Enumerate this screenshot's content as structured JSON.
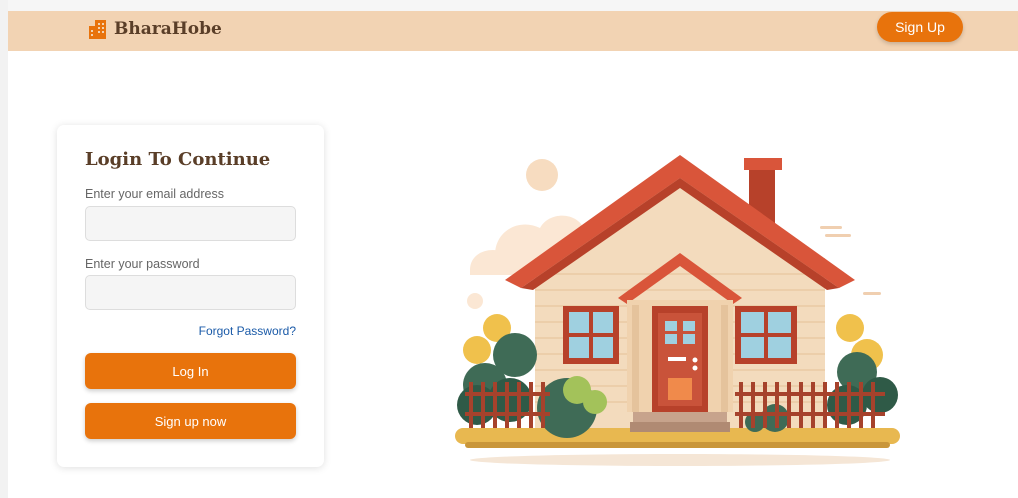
{
  "header": {
    "brand_name": "BharaHobe",
    "signup_label": "Sign Up"
  },
  "login": {
    "title": "Login To Continue",
    "email_label": "Enter your email address",
    "email_value": "",
    "password_label": "Enter your password",
    "password_value": "",
    "forgot_label": "Forgot Password?",
    "login_label": "Log In",
    "signup_label": "Sign up now"
  },
  "icons": {
    "brand": "building-icon",
    "illustration": "house-illustration"
  },
  "colors": {
    "accent": "#e8730c",
    "header_bg": "#f2d3b3",
    "title_text": "#5a3e28",
    "link": "#1a5aa8"
  }
}
